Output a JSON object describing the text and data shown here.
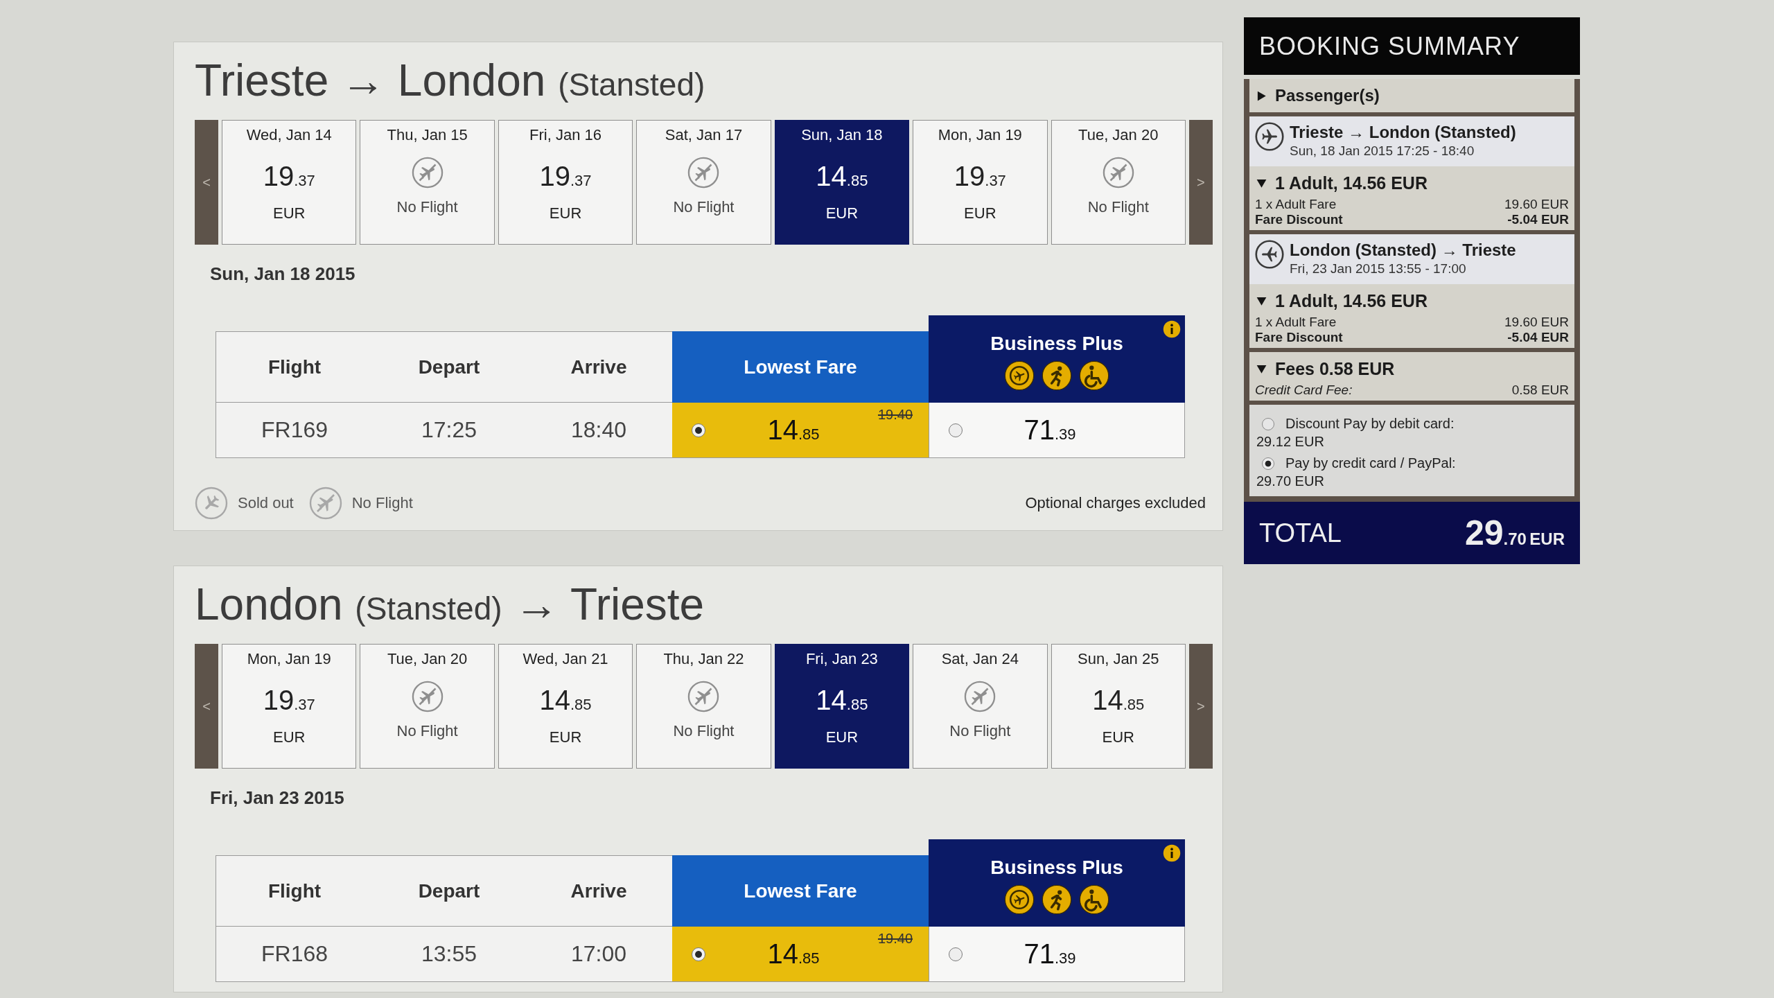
{
  "journeys": [
    {
      "title": [
        {
          "kind": "city",
          "text": "Trieste"
        },
        {
          "kind": "arrow",
          "text": "→"
        },
        {
          "kind": "city",
          "text": "London"
        },
        {
          "kind": "airport",
          "text": "(Stansted)"
        }
      ],
      "prev": "<",
      "next": ">",
      "dates": [
        {
          "kind": "fare",
          "day": "Wed, Jan 14",
          "price": "19.37",
          "currency": "EUR",
          "selected": false
        },
        {
          "kind": "no_flight",
          "day": "Thu, Jan 15",
          "status": "No Flight",
          "selected": false
        },
        {
          "kind": "fare",
          "day": "Fri, Jan 16",
          "price": "19.37",
          "currency": "EUR",
          "selected": false
        },
        {
          "kind": "no_flight",
          "day": "Sat, Jan 17",
          "status": "No Flight",
          "selected": false
        },
        {
          "kind": "fare",
          "day": "Sun, Jan 18",
          "price": "14.85",
          "currency": "EUR",
          "selected": true
        },
        {
          "kind": "fare",
          "day": "Mon, Jan 19",
          "price": "19.37",
          "currency": "EUR",
          "selected": false
        },
        {
          "kind": "no_flight",
          "day": "Tue, Jan 20",
          "status": "No Flight",
          "selected": false
        }
      ],
      "selected_date": "Sun, Jan 18 2015",
      "columns": [
        "Flight",
        "Depart",
        "Arrive"
      ],
      "fare_columns": [
        {
          "kind": "lowest",
          "label": "Lowest Fare"
        },
        {
          "kind": "business",
          "label": "Business Plus"
        }
      ],
      "flights": [
        {
          "flight": "FR169",
          "depart": "17:25",
          "arrive": "18:40",
          "fares": [
            {
              "price": "14.85",
              "was": "19.40",
              "selected": true
            },
            {
              "price": "71.39",
              "selected": false
            }
          ]
        }
      ],
      "legend": [
        {
          "kind": "sold_out",
          "label": "Sold out"
        },
        {
          "kind": "no_flight",
          "label": "No Flight"
        }
      ],
      "note": "Optional charges excluded"
    },
    {
      "title": [
        {
          "kind": "city",
          "text": "London"
        },
        {
          "kind": "airport",
          "text": "(Stansted)"
        },
        {
          "kind": "arrow",
          "text": "→"
        },
        {
          "kind": "city",
          "text": "Trieste"
        }
      ],
      "prev": "<",
      "next": ">",
      "dates": [
        {
          "kind": "fare",
          "day": "Mon, Jan 19",
          "price": "19.37",
          "currency": "EUR",
          "selected": false
        },
        {
          "kind": "no_flight",
          "day": "Tue, Jan 20",
          "status": "No Flight",
          "selected": false
        },
        {
          "kind": "fare",
          "day": "Wed, Jan 21",
          "price": "14.85",
          "currency": "EUR",
          "selected": false
        },
        {
          "kind": "no_flight",
          "day": "Thu, Jan 22",
          "status": "No Flight",
          "selected": false
        },
        {
          "kind": "fare",
          "day": "Fri, Jan 23",
          "price": "14.85",
          "currency": "EUR",
          "selected": true
        },
        {
          "kind": "no_flight",
          "day": "Sat, Jan 24",
          "status": "No Flight",
          "selected": false
        },
        {
          "kind": "fare",
          "day": "Sun, Jan 25",
          "price": "14.85",
          "currency": "EUR",
          "selected": false
        }
      ],
      "selected_date": "Fri, Jan 23 2015",
      "columns": [
        "Flight",
        "Depart",
        "Arrive"
      ],
      "fare_columns": [
        {
          "kind": "lowest",
          "label": "Lowest Fare"
        },
        {
          "kind": "business",
          "label": "Business Plus"
        }
      ],
      "flights": [
        {
          "flight": "FR168",
          "depart": "13:55",
          "arrive": "17:00",
          "fares": [
            {
              "price": "14.85",
              "was": "19.40",
              "selected": true
            },
            {
              "price": "71.39",
              "selected": false
            }
          ]
        }
      ]
    }
  ],
  "summary": {
    "title": "BOOKING SUMMARY",
    "sections": [
      {
        "kind": "toggle",
        "label": "Passenger(s)",
        "expanded": false
      },
      {
        "kind": "outbound",
        "route": "Trieste → London (Stansted)",
        "time": "Sun, 18 Jan 2015 17:25 - 18:40"
      },
      {
        "kind": "group",
        "label": "1 Adult, 14.56 EUR",
        "expanded": true,
        "lines": [
          {
            "kind": "charge",
            "label": "1 x Adult Fare",
            "amount": "19.60 EUR"
          },
          {
            "kind": "discount",
            "label": "Fare Discount",
            "amount": "-5.04 EUR"
          }
        ]
      },
      {
        "kind": "inbound",
        "route": "London (Stansted) → Trieste",
        "time": "Fri, 23 Jan 2015 13:55 - 17:00"
      },
      {
        "kind": "group",
        "label": "1 Adult, 14.56 EUR",
        "expanded": true,
        "lines": [
          {
            "kind": "charge",
            "label": "1 x Adult Fare",
            "amount": "19.60 EUR"
          },
          {
            "kind": "discount",
            "label": "Fare Discount",
            "amount": "-5.04 EUR"
          }
        ]
      },
      {
        "kind": "group",
        "label": "Fees 0.58 EUR",
        "expanded": true,
        "lines": [
          {
            "kind": "fee",
            "label": "Credit Card Fee:",
            "amount": "0.58 EUR"
          }
        ]
      },
      {
        "kind": "payment",
        "options": [
          {
            "label": "Discount Pay by debit card:",
            "amount": "29.12 EUR",
            "selected": false
          },
          {
            "label": "Pay by credit card / PayPal:",
            "amount": "29.70 EUR",
            "selected": true
          }
        ]
      }
    ],
    "total": {
      "label": "TOTAL",
      "amount": "29.70",
      "currency": "EUR"
    }
  }
}
